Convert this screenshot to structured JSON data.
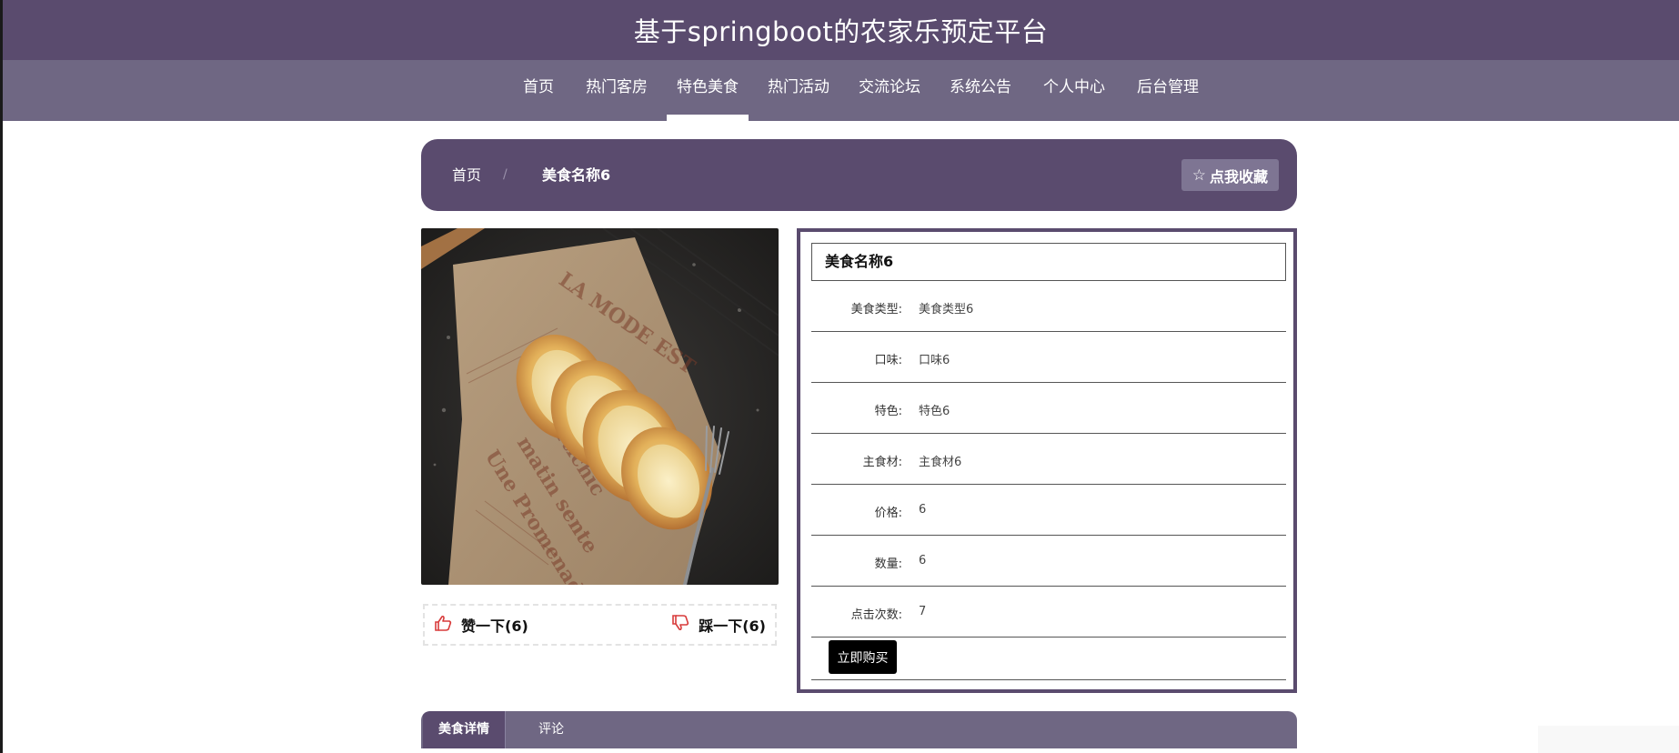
{
  "app": {
    "title": "基于springboot的农家乐预定平台"
  },
  "nav": {
    "items": [
      {
        "label": "首页"
      },
      {
        "label": "热门客房"
      },
      {
        "label": "特色美食"
      },
      {
        "label": "热门活动"
      },
      {
        "label": "交流论坛"
      },
      {
        "label": "系统公告"
      },
      {
        "label": "个人中心"
      },
      {
        "label": "后台管理"
      }
    ],
    "active": "特色美食"
  },
  "breadcrumb": {
    "home": "首页",
    "separator": "/",
    "current": "美食名称6"
  },
  "favorite": {
    "label": "点我收藏",
    "icon": "star-outline-icon"
  },
  "votes": {
    "like_label": "赞一下(6)",
    "like_icon": "thumbs-up-icon",
    "dislike_label": "踩一下(6)",
    "dislike_icon": "thumbs-down-icon"
  },
  "detail": {
    "title": "美食名称6",
    "rows": [
      {
        "key": "美食类型:",
        "value": "美食类型6"
      },
      {
        "key": "口味:",
        "value": "口味6"
      },
      {
        "key": "特色:",
        "value": "特色6"
      },
      {
        "key": "主食材:",
        "value": "主食材6"
      },
      {
        "key": "价格:",
        "value": "6"
      },
      {
        "key": "数量:",
        "value": "6"
      },
      {
        "key": "点击次数:",
        "value": "7"
      }
    ],
    "buy_label": "立即购买"
  },
  "tabs": [
    {
      "label": "美食详情"
    },
    {
      "label": "评论"
    }
  ],
  "colors": {
    "primary": "#5a4b6e",
    "secondary": "#6f6783",
    "accent_red": "#d83b3b"
  }
}
